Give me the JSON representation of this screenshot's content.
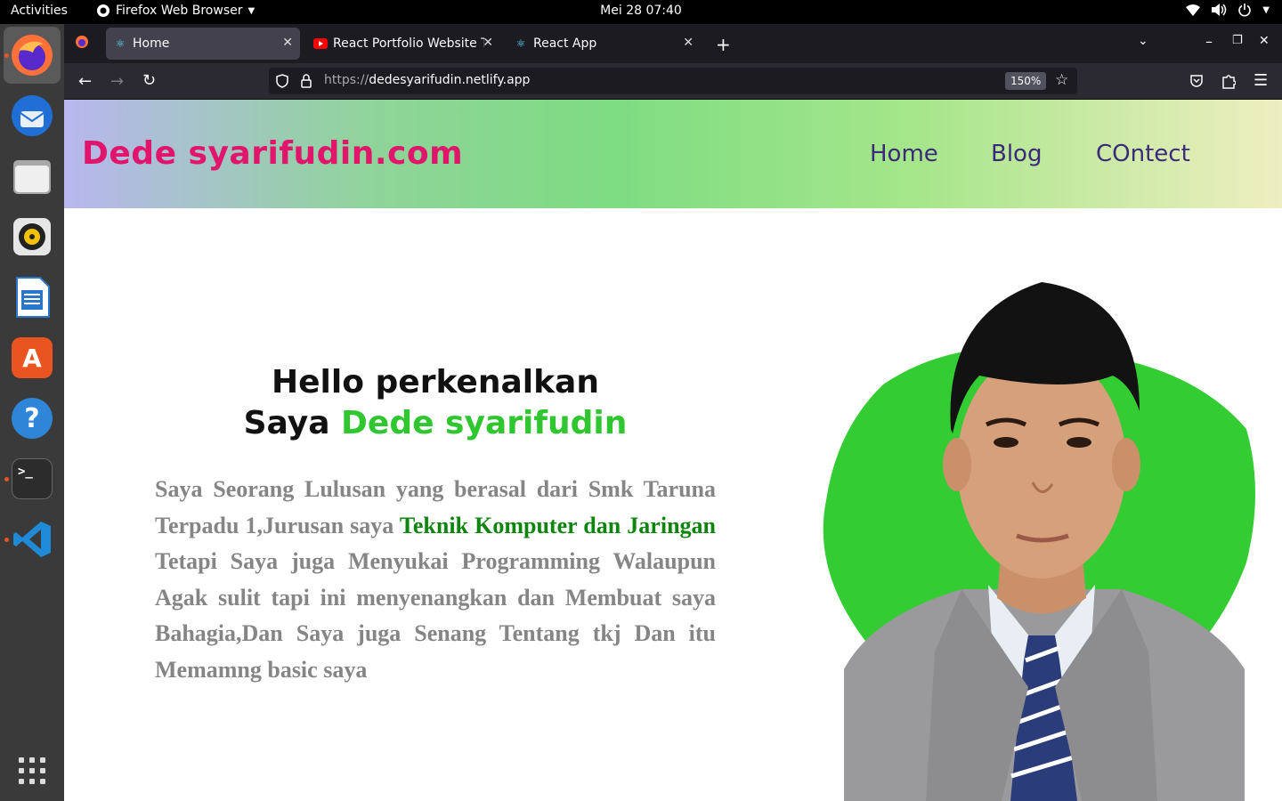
{
  "topbar": {
    "activities": "Activities",
    "app_name": "Firefox Web Browser",
    "clock": "Mei 28  07:40"
  },
  "dock": {
    "apps": [
      "Firefox",
      "Thunderbird",
      "Files",
      "Rhythmbox",
      "LibreOffice Writer",
      "Ubuntu Software",
      "Help",
      "Terminal",
      "Visual Studio Code"
    ]
  },
  "browser": {
    "tabs": [
      {
        "label": "Home",
        "selected": true
      },
      {
        "label": "React Portfolio Website T",
        "selected": false
      },
      {
        "label": "React App",
        "selected": false
      }
    ],
    "url_protocol": "https://",
    "url_host": "dedesyarifudin.netlify.app",
    "zoom": "150%"
  },
  "site": {
    "brand": "Dede syarifudin.com",
    "nav": [
      "Home",
      "Blog",
      "COntect"
    ],
    "hero": {
      "line1": "Hello perkenalkan",
      "line2_prefix": "Saya ",
      "line2_name": "Dede syarifudin",
      "para_part1": "Saya Seorang Lulusan yang berasal dari Smk Taruna Terpadu 1,Jurusan saya ",
      "para_highlight": "Teknik Komputer dan Jaringan",
      "para_part2": " Tetapi Saya juga Menyukai Programming Walaupun Agak sulit tapi ini menyenangkan dan Membuat saya Bahagia,Dan Saya juga Senang Tentang tkj Dan itu Memamng basic saya"
    }
  },
  "colors": {
    "brand": "#e0156b",
    "nav": "#3b2a7a",
    "name_green": "#2fc62f",
    "highlight_green": "#0d850d",
    "blob": "#33cc33"
  }
}
